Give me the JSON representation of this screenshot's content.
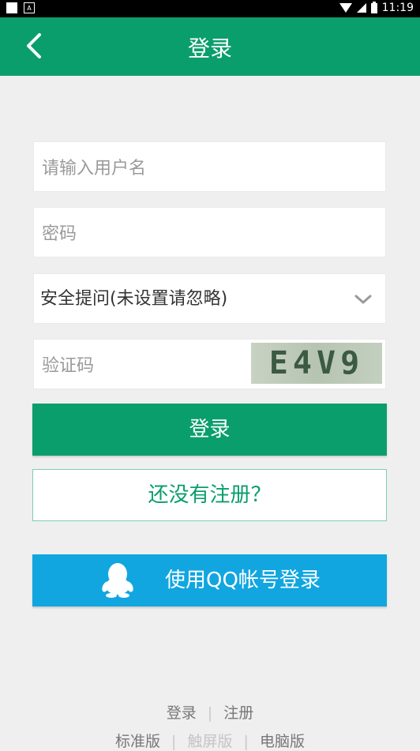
{
  "status_bar": {
    "time": "11:19"
  },
  "header": {
    "title": "登录"
  },
  "form": {
    "username_placeholder": "请输入用户名",
    "password_placeholder": "密码",
    "security_question_selected": "安全提问(未设置请忽略)",
    "captcha_placeholder": "验证码",
    "captcha_text": "E4V9"
  },
  "buttons": {
    "login": "登录",
    "register": "还没有注册？",
    "qq_login": "使用QQ帐号登录"
  },
  "footer": {
    "link_login": "登录",
    "link_register": "注册",
    "separator": "|",
    "version_standard": "标准版",
    "version_touch": "触屏版",
    "version_desktop": "电脑版"
  },
  "colors": {
    "primary": "#0a9e6d",
    "qq_blue": "#11a6e0",
    "background": "#efefef"
  }
}
